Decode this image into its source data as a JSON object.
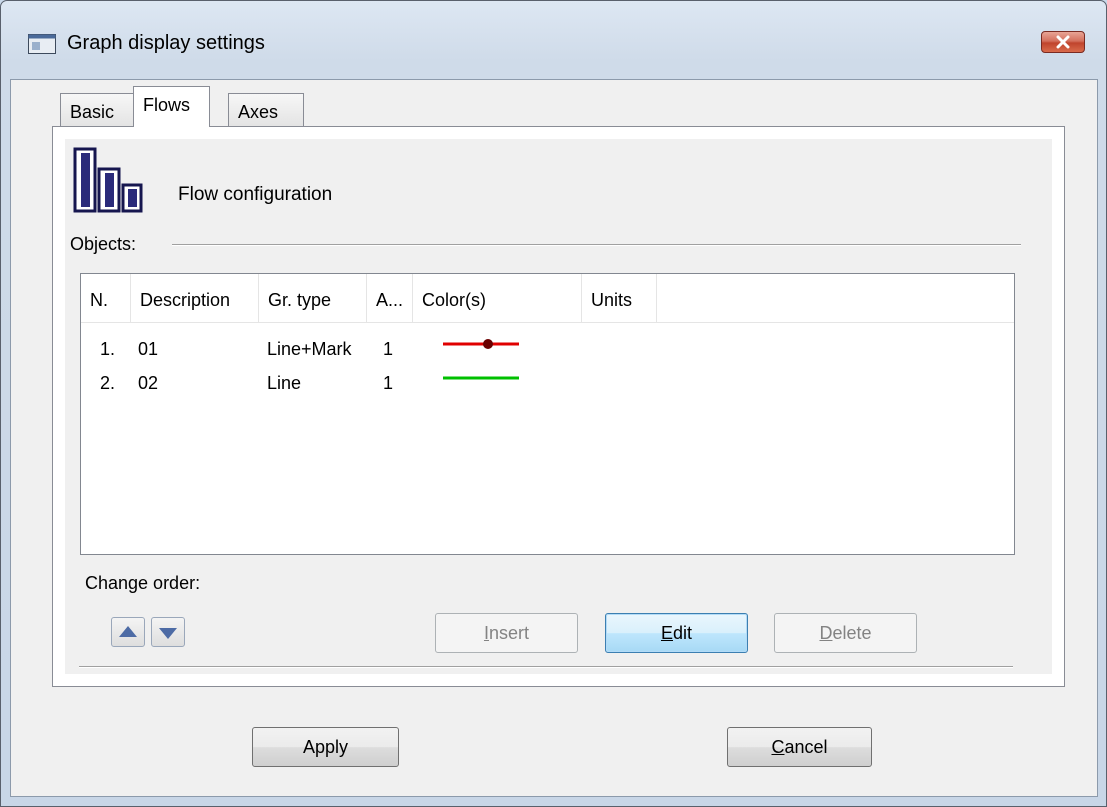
{
  "window": {
    "title": "Graph display settings",
    "close_icon": "close-icon"
  },
  "tabs": [
    {
      "label": "Basic",
      "active": false
    },
    {
      "label": "Flows",
      "active": true
    },
    {
      "label": "Axes",
      "active": false
    }
  ],
  "panel": {
    "icon": "bar-chart-icon",
    "heading": "Flow configuration",
    "objects_label": "Objects:"
  },
  "list": {
    "columns": [
      "N.",
      "Description",
      "Gr. type",
      "A...",
      "Color(s)",
      "Units"
    ],
    "rows": [
      {
        "n": "1.",
        "description": "01",
        "gr_type": "Line+Mark",
        "a": "1",
        "color": "#e00000",
        "marker": true,
        "units": ""
      },
      {
        "n": "2.",
        "description": "02",
        "gr_type": "Line",
        "a": "1",
        "color": "#00c000",
        "marker": false,
        "units": ""
      }
    ]
  },
  "order": {
    "label": "Change order:",
    "up_icon": "arrow-up-icon",
    "down_icon": "arrow-down-icon"
  },
  "buttons": {
    "insert_first": "I",
    "insert_rest": "nsert",
    "edit_first": "E",
    "edit_rest": "dit",
    "delete_first": "D",
    "delete_rest": "elete",
    "apply": "Apply",
    "cancel_first": "C",
    "cancel_rest": "ancel"
  }
}
